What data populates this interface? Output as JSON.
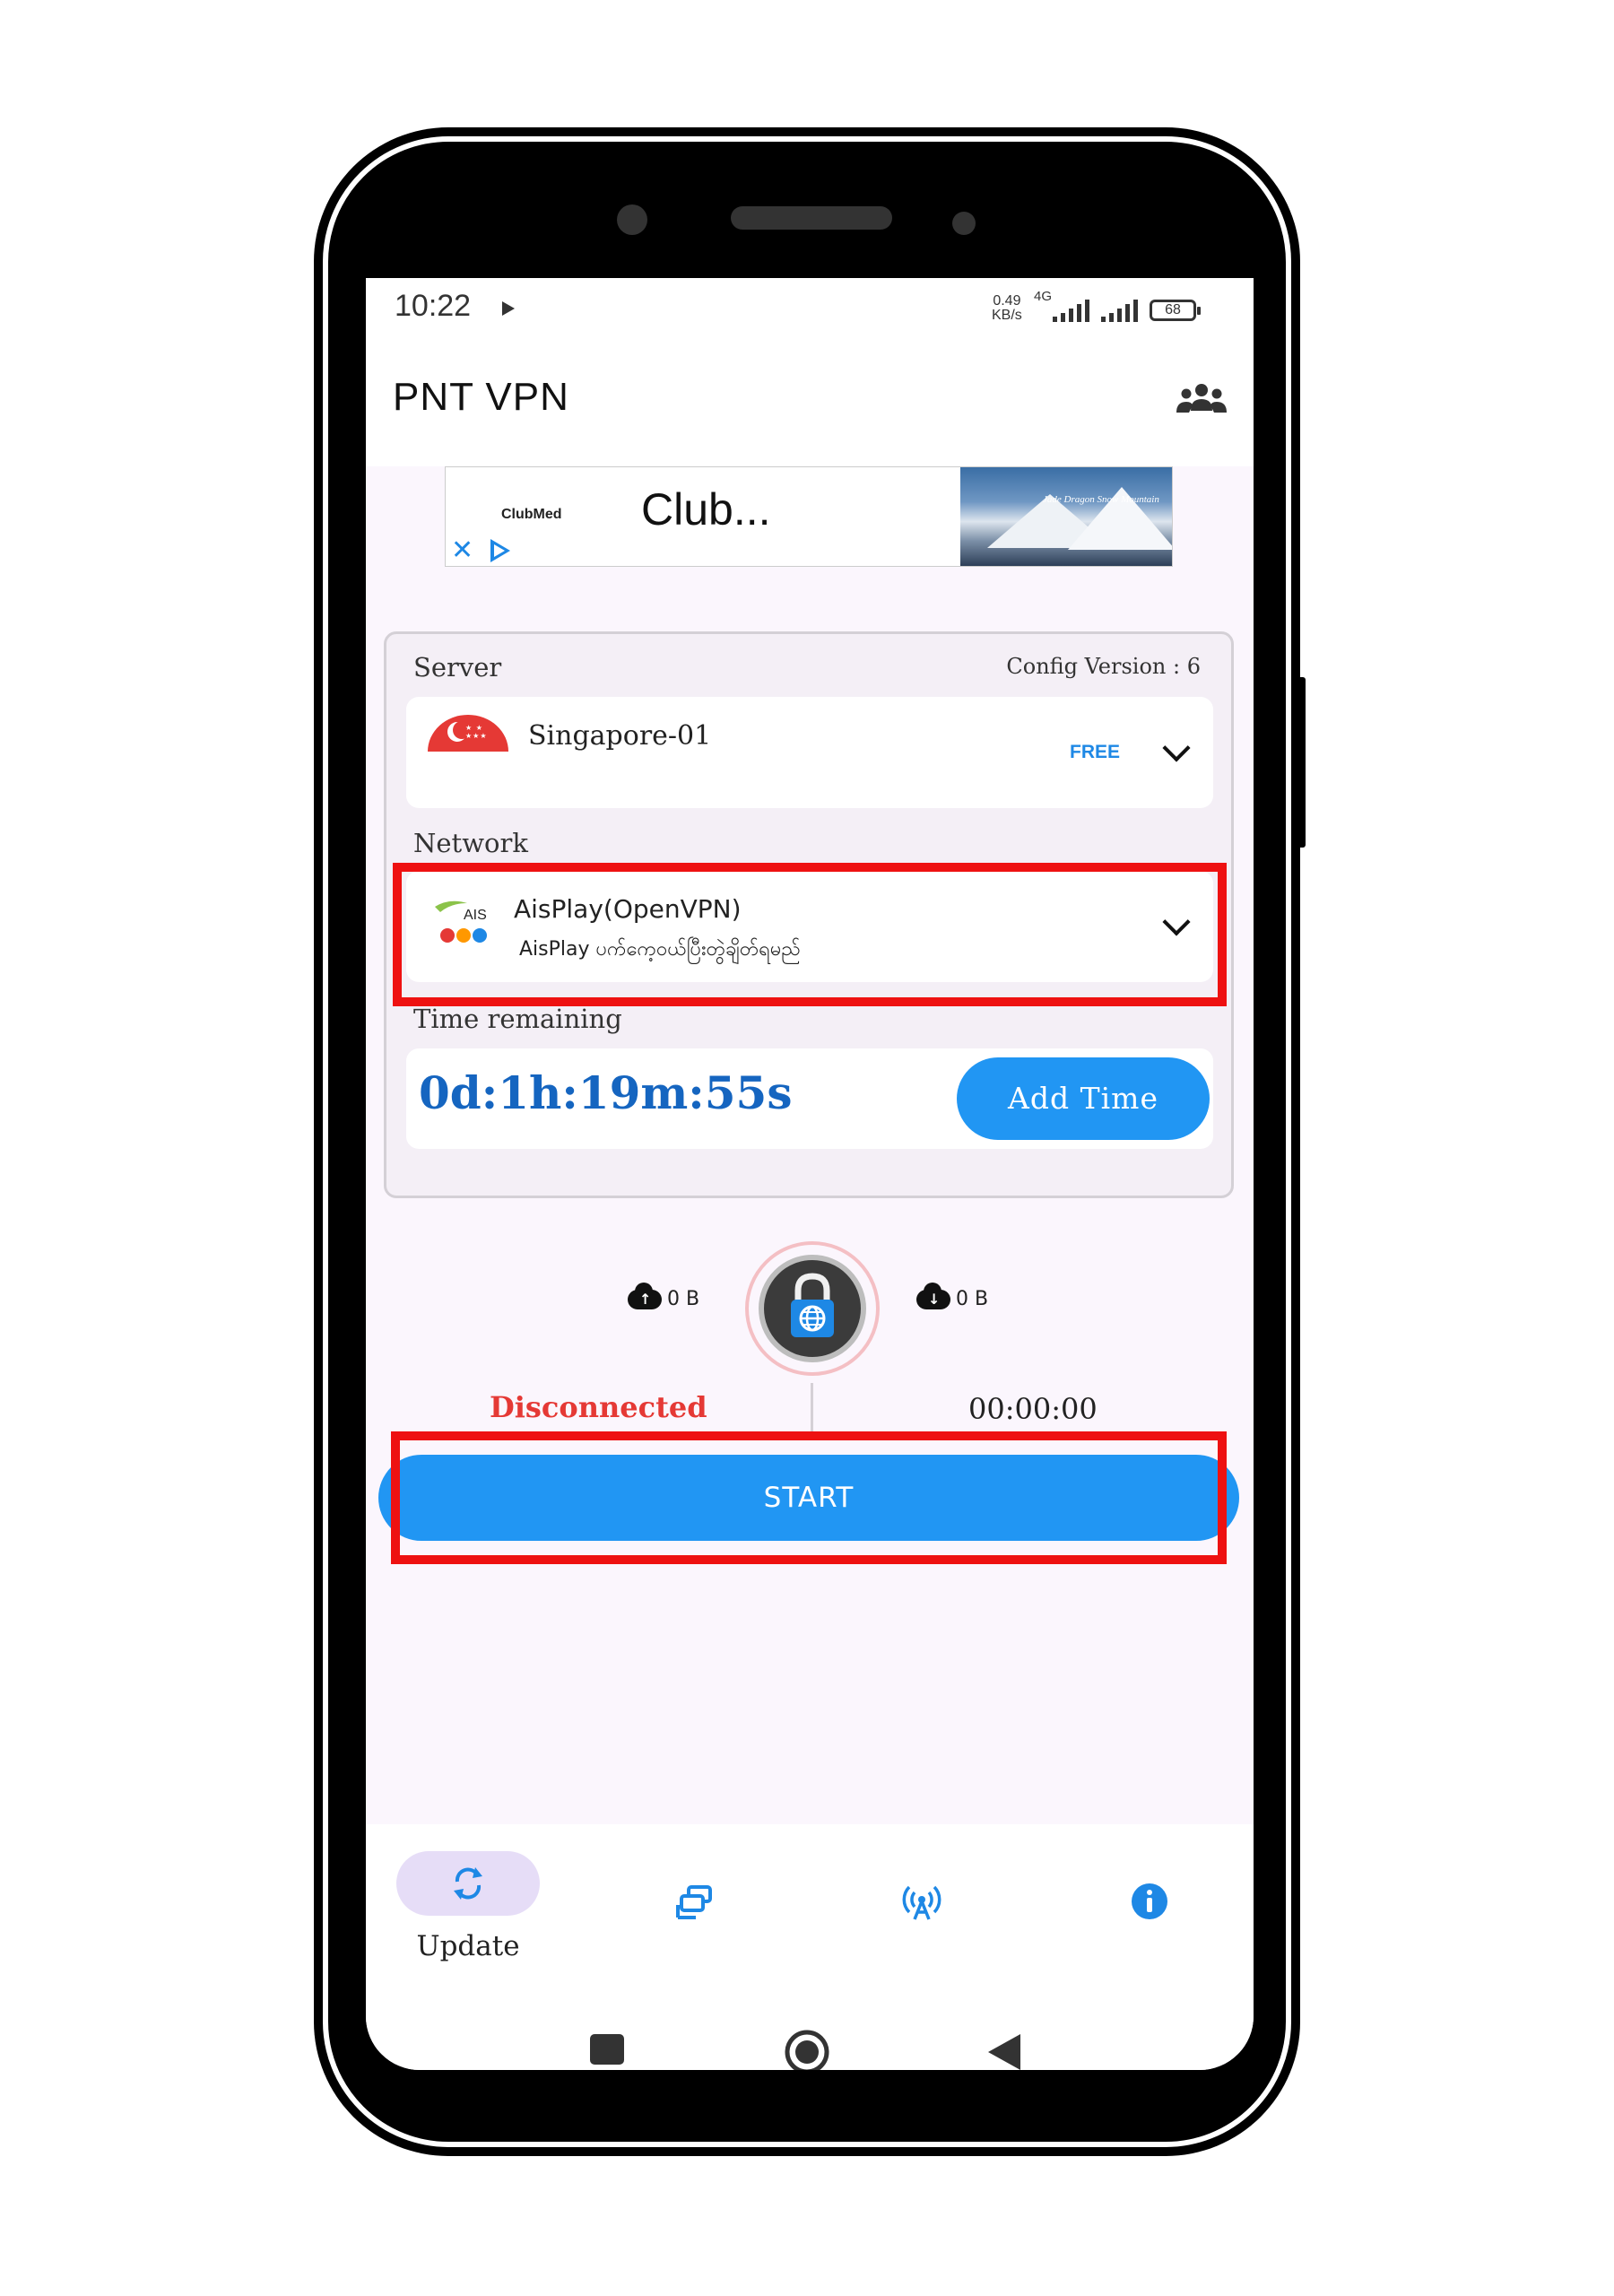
{
  "status_bar": {
    "time": "10:22",
    "net_speed_value": "0.49",
    "net_speed_unit": "KB/s",
    "network_type": "4G",
    "battery": "68"
  },
  "app": {
    "title": "PNT VPN"
  },
  "ad": {
    "brand": "ClubMed",
    "headline": "Club...",
    "image_caption": "Jade Dragon Snow Mountain"
  },
  "server": {
    "label": "Server",
    "config_version": "Config Version : 6",
    "name": "Singapore-01",
    "badge": "FREE"
  },
  "network": {
    "label": "Network",
    "logo_text": "AIS",
    "title": "AisPlay(OpenVPN)",
    "subtitle": "AisPlay ပက်ကေ့ဝယ်ပြီးတွဲချိတ်ရမည်"
  },
  "time_remaining": {
    "label": "Time remaining",
    "value": "0d:1h:19m:55s",
    "add_button": "Add Time"
  },
  "traffic": {
    "upload": "0 B",
    "download": "0 B"
  },
  "connection": {
    "status": "Disconnected",
    "duration": "00:00:00",
    "start_button": "START"
  },
  "bottom_nav": {
    "items": [
      {
        "label": "Update",
        "icon": "refresh-icon",
        "active": true
      },
      {
        "icon": "servers-icon"
      },
      {
        "icon": "antenna-icon"
      },
      {
        "icon": "info-icon"
      }
    ]
  },
  "colors": {
    "accent": "#2196f3",
    "disconnected": "#e53935",
    "highlight": "#ee1111",
    "timer": "#1565c0"
  }
}
